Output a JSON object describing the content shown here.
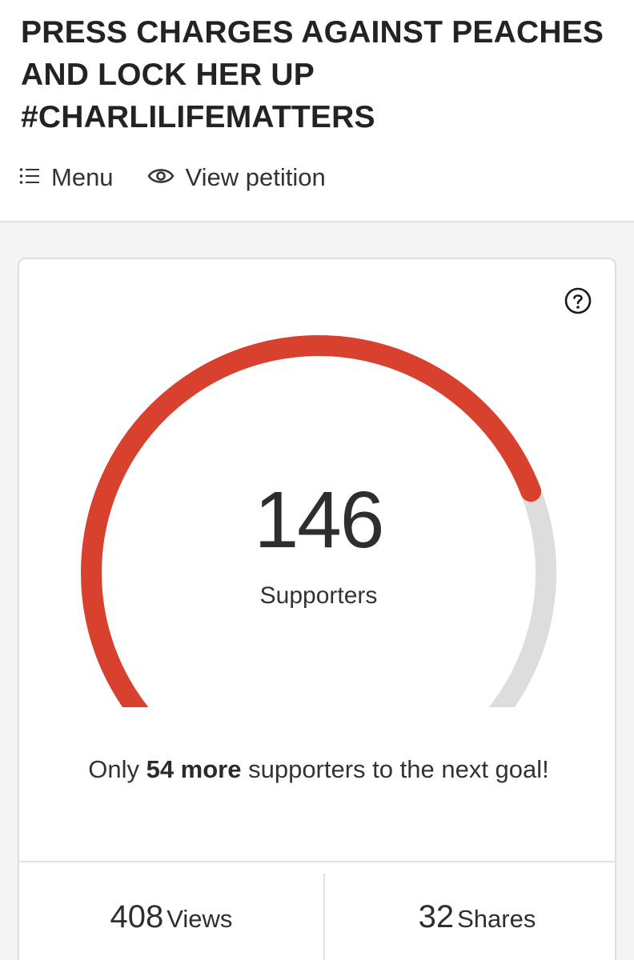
{
  "petition": {
    "title": "PRESS CHARGES AGAINST PEACHES AND LOCK HER UP #CHARLILIFEMATTERS"
  },
  "nav": {
    "menu_label": "Menu",
    "view_label": "View petition"
  },
  "progress": {
    "supporters_count": "146",
    "supporters_label": "Supporters",
    "goal_fraction": 0.73,
    "goal_prefix": "Only ",
    "goal_bold": "54 more",
    "goal_suffix": " supporters to the next goal!"
  },
  "stats": {
    "views_count": "408",
    "views_label": "Views",
    "shares_count": "32",
    "shares_label": "Shares"
  },
  "colors": {
    "accent": "#d9412f",
    "track": "#dddddd"
  },
  "icons": {
    "menu": "list-icon",
    "view": "eye-icon",
    "help": "question-circle-icon"
  }
}
